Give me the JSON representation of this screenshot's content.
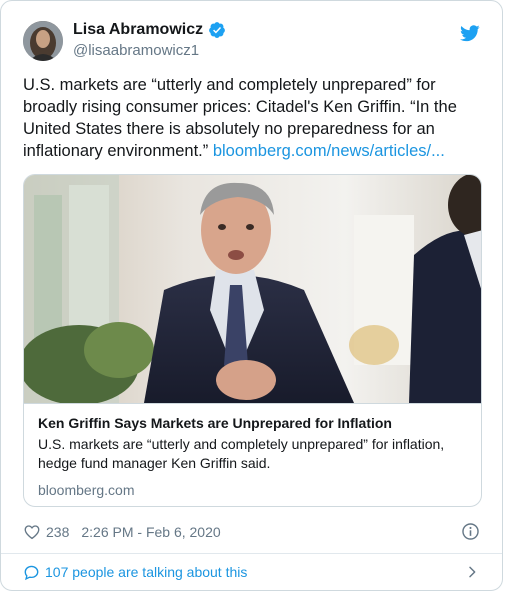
{
  "author": {
    "display_name": "Lisa Abramowicz",
    "handle": "@lisaabramowicz1"
  },
  "tweet": {
    "text": "U.S. markets are “utterly and completely unprepared” for broadly rising consumer prices: Citadel's Ken Griffin. “In the United States there is absolutely no preparedness for an inflationary environment.” ",
    "link_text": "bloomberg.com/news/articles/..."
  },
  "card": {
    "title": "Ken Griffin Says Markets are Unprepared for Inflation",
    "description": "U.S. markets are “utterly and completely unprepared” for inflation, hedge fund manager Ken Griffin said.",
    "domain": "bloomberg.com"
  },
  "meta": {
    "likes": "238",
    "timestamp": "2:26 PM - Feb 6, 2020"
  },
  "footer": {
    "talking_text": "107 people are talking about this"
  },
  "colors": {
    "link": "#1b95e0",
    "secondary_text": "#657786",
    "border": "#cfd9de"
  },
  "icons": [
    "verified-badge-icon",
    "twitter-bird-icon",
    "heart-icon",
    "info-icon",
    "speech-bubble-icon",
    "chevron-right-icon"
  ]
}
